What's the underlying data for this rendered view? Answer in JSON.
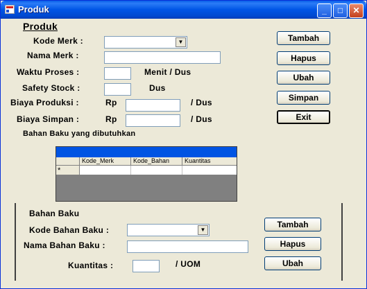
{
  "window": {
    "title": "Produk",
    "controls": {
      "minimize": "_",
      "maximize": "□",
      "close": "✕"
    }
  },
  "section1": {
    "heading": "Produk",
    "kode_merk_label": "Kode Merk :",
    "nama_merk_label": "Nama Merk :",
    "waktu_proses_label": "Waktu Proses :",
    "waktu_proses_unit": "Menit / Dus",
    "safety_stock_label": "Safety Stock :",
    "safety_stock_unit": "Dus",
    "biaya_produksi_label": "Biaya Produksi :",
    "biaya_produksi_prefix": "Rp",
    "biaya_produksi_unit": "/ Dus",
    "biaya_simpan_label": "Biaya Simpan :",
    "biaya_simpan_prefix": "Rp",
    "biaya_simpan_unit": "/ Dus",
    "kode_merk_value": "",
    "nama_merk_value": "",
    "waktu_proses_value": "",
    "safety_stock_value": "",
    "biaya_produksi_value": "",
    "biaya_simpan_value": ""
  },
  "buttons_top": {
    "tambah": "Tambah",
    "hapus": "Hapus",
    "ubah": "Ubah",
    "simpan": "Simpan",
    "exit": "Exit"
  },
  "bahan_caption": "Bahan Baku yang dibutuhkan",
  "grid": {
    "columns": [
      "Kode_Merk",
      "Kode_Bahan",
      "Kuantitas"
    ],
    "new_row_marker": "*"
  },
  "section2": {
    "heading": "Bahan Baku",
    "kode_bahan_label": "Kode Bahan Baku :",
    "nama_bahan_label": "Nama Bahan Baku :",
    "kuantitas_label": "Kuantitas :",
    "kuantitas_unit": "/ UOM",
    "kode_bahan_value": "",
    "nama_bahan_value": "",
    "kuantitas_value": ""
  },
  "buttons_bottom": {
    "tambah": "Tambah",
    "hapus": "Hapus",
    "ubah": "Ubah"
  }
}
